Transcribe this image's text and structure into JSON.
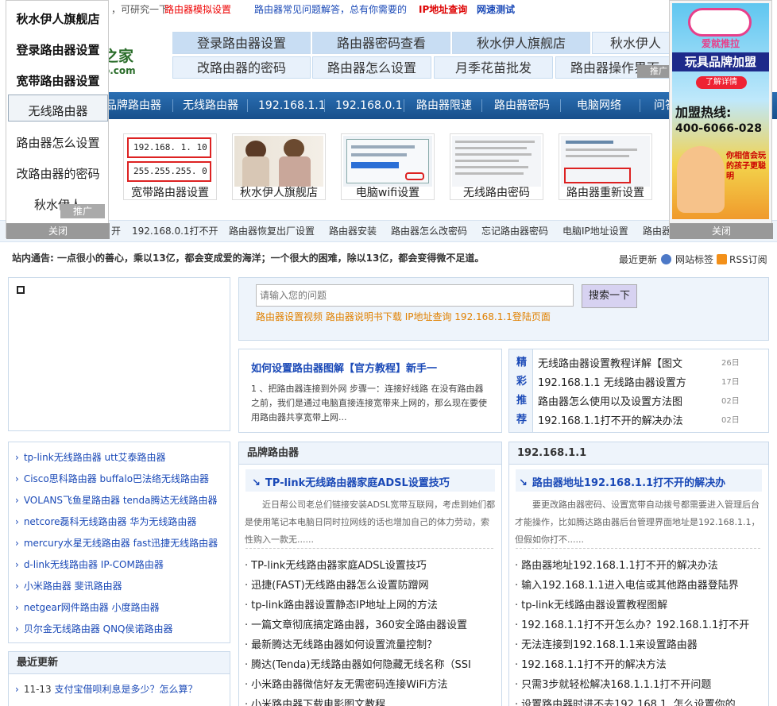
{
  "topbar": {
    "intro_text": "，可研究一下",
    "link_simulator": "路由器模拟设置",
    "link_faq": "路由器常见问题解答，总有你需要的",
    "link_ip": "IP地址查询",
    "link_speed": "网速测试"
  },
  "logo": {
    "main": "之家",
    "sub": "o.com"
  },
  "top_links": [
    [
      "登录路由器设置",
      "路由器密码查看",
      "秋水伊人旗舰店",
      "秋水伊人"
    ],
    [
      "改路由器的密码",
      "路由器怎么设置",
      "月季花苗批发",
      "路由器操作界面"
    ]
  ],
  "nav": [
    "品牌路由器",
    "无线路由器",
    "192.168.1.1",
    "192.168.0.1",
    "路由器限速",
    "路由器密码",
    "电脑网络",
    "问答"
  ],
  "thumbs": [
    {
      "caption": "宽带路由器设置",
      "ip1": [
        "192",
        ".168",
        ". 1",
        ". 10"
      ],
      "ip2": [
        "255",
        ".255",
        ".255",
        ". 0"
      ]
    },
    {
      "caption": "秋水伊人旗舰店"
    },
    {
      "caption": "电脑wifi设置"
    },
    {
      "caption": "无线路由密码"
    },
    {
      "caption": "路由器重新设置"
    }
  ],
  "crumbs": [
    "开",
    "192.168.0.1打不开",
    "路由器恢复出厂设置",
    "路由器安装",
    "路由器怎么改密码",
    "忘记路由器密码",
    "电脑IP地址设置",
    "路由器"
  ],
  "notice": "站内通告: 一点很小的善心，乘以13亿，都会变成爱的海洋；一个很大的困难，除以13亿，都会变得微不足道。",
  "notice_links": {
    "recent": "最近更新",
    "tags": "网站标签",
    "rss": "RSS订阅"
  },
  "search": {
    "placeholder": "请输入您的问题",
    "button": "搜索一下",
    "hot": [
      "路由器设置视频",
      "路由器说明书下载",
      "IP地址查询",
      "192.168.1.1登陆页面"
    ]
  },
  "featured": {
    "title": "如何设置路由器图解【官方教程】新手一",
    "text": "1 、把路由器连接到外网 步骤一：连接好线路 在没有路由器之前，我们是通过电脑直接连接宽带来上网的，那么现在要使用路由器共享宽带上网..."
  },
  "picks": {
    "side": [
      "精",
      "彩",
      "推",
      "荐"
    ],
    "items": [
      {
        "title": "无线路由器设置教程详解【图文",
        "date": "26日"
      },
      {
        "title": "192.168.1.1 无线路由器设置方",
        "date": "17日"
      },
      {
        "title": "路由器怎么使用以及设置方法图",
        "date": "02日"
      },
      {
        "title": "192.168.1.1打不开的解决办法",
        "date": "02日"
      }
    ]
  },
  "brands": [
    "tp-link无线路由器 utt艾泰路由器",
    "Cisco思科路由器 buffalo巴法络无线路由器",
    "VOLANS飞鱼星路由器 tenda腾达无线路由器",
    "netcore磊科无线路由器 华为无线路由器",
    "mercury水星无线路由器 fast迅捷无线路由器",
    "d-link无线路由器 IP-COM路由器",
    "小米路由器 斐讯路由器",
    "netgear网件路由器 小度路由器",
    "贝尔金无线路由器 QNQ侯诺路由器"
  ],
  "recent": {
    "head": "最近更新",
    "items": [
      {
        "date": "11-13",
        "title": "支付宝借呗利息是多少？怎么算？"
      }
    ]
  },
  "brand_panel": {
    "head": "品牌路由器",
    "lead_title": "TP-link无线路由器家庭ADSL设置技巧",
    "lead_text": "近日帮公司老总们链接安装ADSL宽带互联网，考虑到她们都是使用笔记本电脑日同时拉网线的话也增加自己的体力劳动，索性购入一款无......",
    "items": [
      "TP-link无线路由器家庭ADSL设置技巧",
      "迅捷(FAST)无线路由器怎么设置防蹭网",
      "tp-link路由器设置静态IP地址上网的方法",
      "一篇文章彻底搞定路由器，360安全路由器设置",
      "最新腾达无线路由器如何设置流量控制？",
      "腾达(Tenda)无线路由器如何隐藏无线名称（SSI",
      "小米路由器微信好友无需密码连接WiFi方法",
      "小米路由器下载电影图文教程"
    ]
  },
  "ip_panel": {
    "head": "192.168.1.1",
    "lead_title": "路由器地址192.168.1.1打不开的解决办",
    "lead_text": "要更改路由器密码、设置宽带自动拨号都需要进入管理后台才能操作，比如腾达路由器后台管理界面地址是192.168.1.1，但假如你打不......",
    "items": [
      "路由器地址192.168.1.1打不开的解决办法",
      "输入192.168.1.1进入电信或其他路由器登陆界",
      "tp-link无线路由器设置教程图解",
      "192.168.1.1打不开怎么办？192.168.1.1打不开",
      "无法连接到192.168.1.1来设置路由器",
      "192.168.1.1打不开的解决方法",
      "只需3步就轻松解决168.1.1.1打不开问题",
      "设置路由器时进不去192.168.1. 怎么设置你的"
    ]
  },
  "float_left": {
    "items": [
      "秋水伊人旗舰店",
      "登录路由器设置",
      "宽带路由器设置",
      "无线路由器",
      "路由器怎么设置",
      "改路由器的密码",
      "秋水伊人"
    ],
    "ad_tag": "推广",
    "close": "关闭"
  },
  "float_right": {
    "brand": "爱就推拉",
    "headline": "玩具品牌加盟",
    "detail_btn": "了解详情",
    "hotline_label": "加盟热线:",
    "hotline": "400-6066-028",
    "slogan": "你相信会玩的孩子更聪明",
    "close": "关闭"
  },
  "ad_tag2": "推广"
}
